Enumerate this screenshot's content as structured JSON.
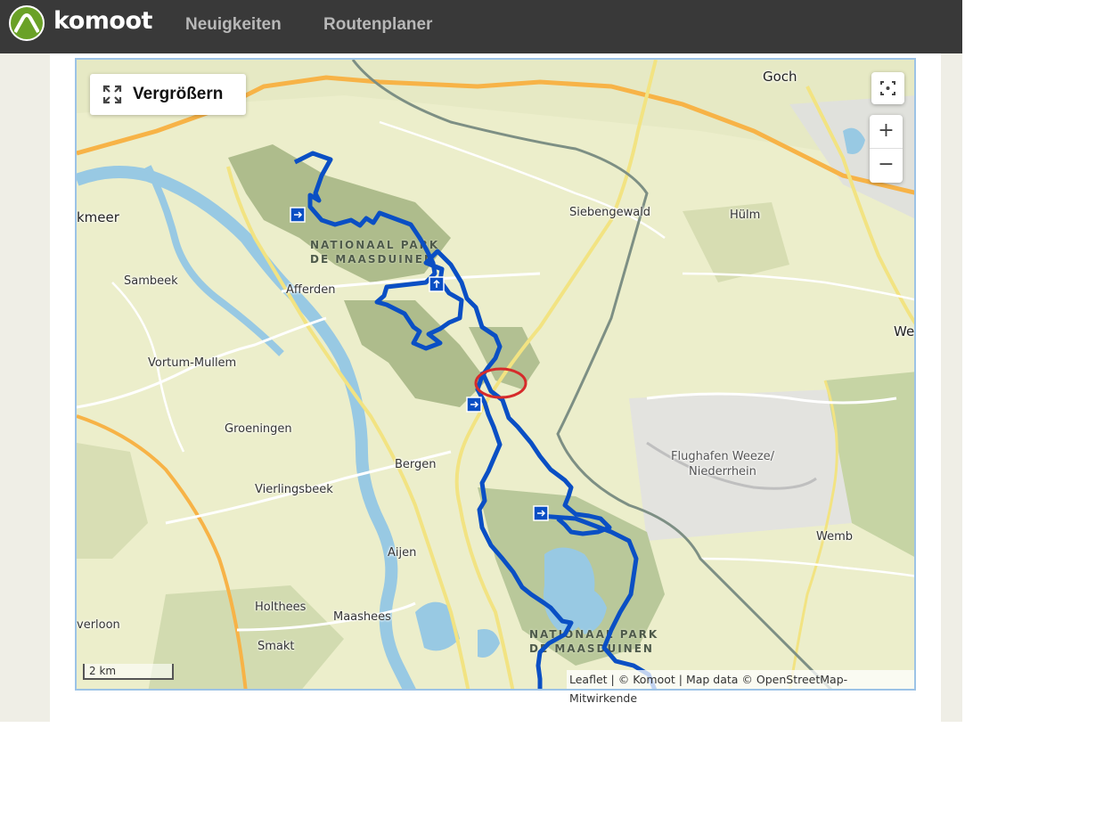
{
  "header": {
    "brand": "komoot",
    "nav": [
      {
        "label": "Neuigkeiten"
      },
      {
        "label": "Routenplaner"
      }
    ]
  },
  "map": {
    "enlarge_label": "Vergrößern",
    "zoom_in": "+",
    "zoom_out": "−",
    "scale": "2 km",
    "attribution": "Leaflet | © Komoot | Map data © OpenStreetMap-Mitwirkende",
    "places": [
      "Goch",
      "kmeer",
      "Siebengewald",
      "Hülm",
      "Sambeek",
      "Afferden",
      "We",
      "Vortum-Mullem",
      "Groeningen",
      "Bergen",
      "Flughafen Weeze/",
      "Niederrhein",
      "Vierlingsbeek",
      "Wemb",
      "Aijen",
      "Holthees",
      "Maashees",
      "verloon",
      "Smakt"
    ],
    "parks": [
      {
        "line1": "NATIONAAL PARK",
        "line2": "DE MAASDUINEN"
      },
      {
        "line1": "NATIONAAL PARK",
        "line2": "DE MAASDUINEN"
      }
    ],
    "route_color": "#0a4fc4",
    "highlight_color": "#d62b2b"
  }
}
